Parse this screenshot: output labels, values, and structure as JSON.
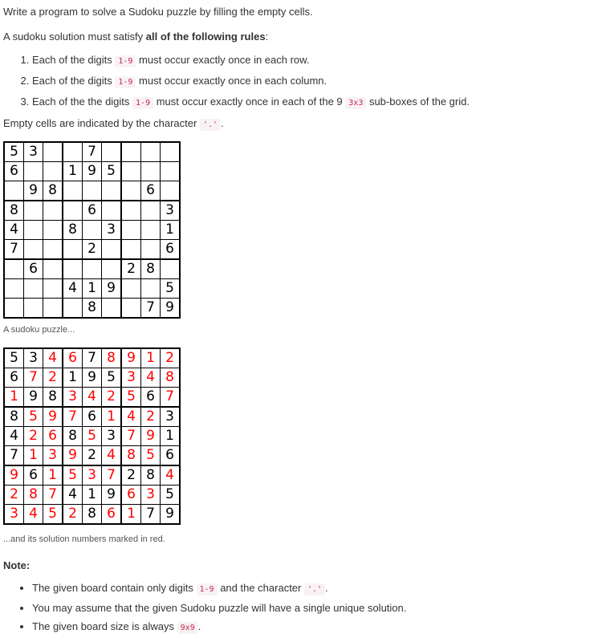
{
  "intro": "Write a program to solve a Sudoku puzzle by filling the empty cells.",
  "rules_intro": {
    "before": "A sudoku solution must satisfy ",
    "bold": "all of the following rules",
    "after": ":"
  },
  "rules": [
    {
      "num": "1.",
      "before": "Each of the digits ",
      "code": "1-9",
      "after": " must occur exactly once in each row."
    },
    {
      "num": "2.",
      "before": "Each of the digits ",
      "code": "1-9",
      "after": " must occur exactly once in each column."
    },
    {
      "num": "3.",
      "before": "Each of the the digits ",
      "code": "1-9",
      "after": " must occur exactly once in each of the 9 ",
      "code2": "3x3",
      "after2": " sub-boxes of the grid."
    }
  ],
  "empty_cells": {
    "before": "Empty cells are indicated by the character ",
    "code": "'.'",
    "after": "."
  },
  "puzzle": [
    [
      "5",
      "3",
      "",
      "",
      "7",
      "",
      "",
      "",
      ""
    ],
    [
      "6",
      "",
      "",
      "1",
      "9",
      "5",
      "",
      "",
      ""
    ],
    [
      "",
      "9",
      "8",
      "",
      "",
      "",
      "",
      "6",
      ""
    ],
    [
      "8",
      "",
      "",
      "",
      "6",
      "",
      "",
      "",
      "3"
    ],
    [
      "4",
      "",
      "",
      "8",
      "",
      "3",
      "",
      "",
      "1"
    ],
    [
      "7",
      "",
      "",
      "",
      "2",
      "",
      "",
      "",
      "6"
    ],
    [
      "",
      "6",
      "",
      "",
      "",
      "",
      "2",
      "8",
      ""
    ],
    [
      "",
      "",
      "",
      "4",
      "1",
      "9",
      "",
      "",
      "5"
    ],
    [
      "",
      "",
      "",
      "",
      "8",
      "",
      "",
      "7",
      "9"
    ]
  ],
  "puzzle_caption": "A sudoku puzzle...",
  "solution": [
    [
      "5",
      "3",
      "4",
      "6",
      "7",
      "8",
      "9",
      "1",
      "2"
    ],
    [
      "6",
      "7",
      "2",
      "1",
      "9",
      "5",
      "3",
      "4",
      "8"
    ],
    [
      "1",
      "9",
      "8",
      "3",
      "4",
      "2",
      "5",
      "6",
      "7"
    ],
    [
      "8",
      "5",
      "9",
      "7",
      "6",
      "1",
      "4",
      "2",
      "3"
    ],
    [
      "4",
      "2",
      "6",
      "8",
      "5",
      "3",
      "7",
      "9",
      "1"
    ],
    [
      "7",
      "1",
      "3",
      "9",
      "2",
      "4",
      "8",
      "5",
      "6"
    ],
    [
      "9",
      "6",
      "1",
      "5",
      "3",
      "7",
      "2",
      "8",
      "4"
    ],
    [
      "2",
      "8",
      "7",
      "4",
      "1",
      "9",
      "6",
      "3",
      "5"
    ],
    [
      "3",
      "4",
      "5",
      "2",
      "8",
      "6",
      "1",
      "7",
      "9"
    ]
  ],
  "solution_caption": "...and its solution numbers marked in red.",
  "colors": {
    "given": "#000000",
    "solved": "#ff0000",
    "code_text": "#c7254e",
    "code_bg": "#f9f2f4"
  },
  "note_title": "Note:",
  "notes": [
    {
      "before": "The given board contain only digits ",
      "code": "1-9",
      "after": " and the character ",
      "code2": "'.'",
      "after2": "."
    },
    {
      "before": "You may assume that the given Sudoku puzzle will have a single unique solution."
    },
    {
      "before": "The given board size is always ",
      "code": "9x9",
      "after": "."
    }
  ]
}
